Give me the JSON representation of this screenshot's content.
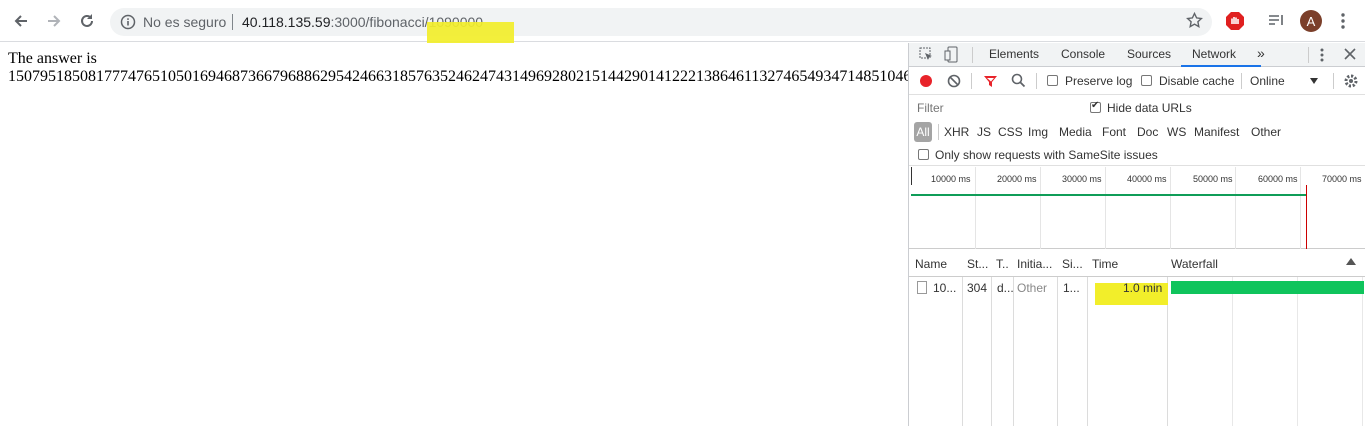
{
  "browser": {
    "security_status": "No es seguro",
    "url_host": "40.118.135.59",
    "url_rest": ":3000/fibonacci/1090000",
    "avatar_letter": "A"
  },
  "page": {
    "line1": "The answer is",
    "line2": "15079518508177747651050169468736679688629542466318576352462474314969280215144290141222138646113274654934714851046"
  },
  "devtools": {
    "tabs": [
      "Elements",
      "Console",
      "Sources",
      "Network"
    ],
    "active_tab": "Network",
    "more_tabs": "»",
    "preserve_log": "Preserve log",
    "disable_cache": "Disable cache",
    "throttle": "Online",
    "filter_placeholder": "Filter",
    "hide_data_urls": "Hide data URLs",
    "types": [
      "All",
      "XHR",
      "JS",
      "CSS",
      "Img",
      "Media",
      "Font",
      "Doc",
      "WS",
      "Manifest",
      "Other"
    ],
    "samesite": "Only show requests with SameSite issues",
    "timeline_ticks": [
      "10000 ms",
      "20000 ms",
      "30000 ms",
      "40000 ms",
      "50000 ms",
      "60000 ms",
      "70000 ms"
    ],
    "columns": [
      "Name",
      "St...",
      "T..",
      "Initia...",
      "Si...",
      "Time",
      "Waterfall"
    ],
    "request": {
      "name": "10...",
      "status": "304",
      "type": "d...",
      "initiator": "Other",
      "size": "1...",
      "time": "1.0 min"
    }
  }
}
